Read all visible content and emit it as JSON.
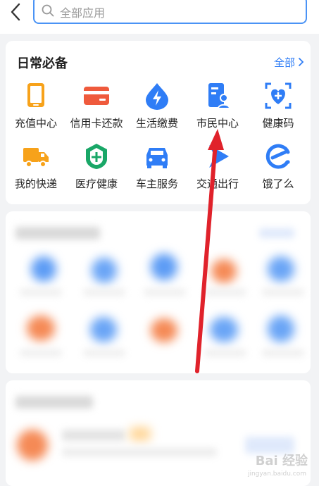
{
  "search": {
    "placeholder": "全部应用"
  },
  "section": {
    "title": "日常必备",
    "more_label": "全部"
  },
  "items": [
    {
      "label": "充值中心",
      "icon": "tablet-icon",
      "color": "#f7a21a"
    },
    {
      "label": "信用卡还款",
      "icon": "credit-card-icon",
      "color": "#ef5a3c"
    },
    {
      "label": "生活缴费",
      "icon": "lightning-drop-icon",
      "color": "#2f7df6"
    },
    {
      "label": "市民中心",
      "icon": "citizen-card-icon",
      "color": "#2f7df6"
    },
    {
      "label": "健康码",
      "icon": "health-heart-icon",
      "color": "#2f7df6"
    },
    {
      "label": "我的快递",
      "icon": "delivery-truck-icon",
      "color": "#f7a21a"
    },
    {
      "label": "医疗健康",
      "icon": "medical-shield-icon",
      "color": "#19a767"
    },
    {
      "label": "车主服务",
      "icon": "car-icon",
      "color": "#2f7df6"
    },
    {
      "label": "交通出行",
      "icon": "transport-arrow-icon",
      "color": "#2f7df6"
    },
    {
      "label": "饿了么",
      "icon": "eleme-icon",
      "color": "#2f7df6"
    }
  ],
  "watermark": {
    "text": "Bai 经验",
    "sub": "jingyan.baidu.com"
  },
  "colors": {
    "accent": "#2f7df6",
    "annotation_arrow": "#e0222b"
  }
}
